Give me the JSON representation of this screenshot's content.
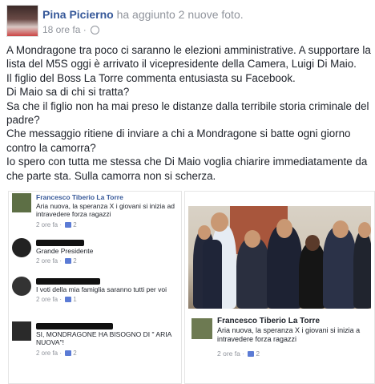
{
  "post": {
    "author": "Pina Picierno",
    "action": "ha aggiunto 2 nuove foto.",
    "time": "18 ore fa",
    "lines": [
      "A Mondragone tra poco ci saranno le elezioni amministrative. A supportare la lista del M5S oggi è arrivato il vicepresidente della Camera, Luigi Di Maio.",
      "Il figlio del Boss La Torre commenta entusiasta su Facebook.",
      "Di Maio sa di chi si tratta?",
      "Sa che il figlio non ha mai preso le distanze dalla terribile storia criminale del padre?",
      "Che messaggio ritiene di inviare a chi a Mondragone si batte ogni giorno contro la camorra?",
      "Io spero con tutta me stessa che Di Maio voglia chiarire immediatamente da che parte sta. Sulla camorra non si scherza."
    ]
  },
  "left_screenshot": {
    "comments": [
      {
        "name": "Francesco Tiberio La Torre",
        "text": "Aria nuova, la speranza X i giovani si inizia ad intravedere forza ragazzi",
        "meta": "2 ore fa",
        "likes": "2"
      },
      {
        "name": "",
        "text": "Grande Presidente",
        "meta": "2 ore fa",
        "likes": "2"
      },
      {
        "name": "",
        "text": "I voti della mia famiglia saranno tutti per voi",
        "meta": "2 ore fa",
        "likes": "1"
      },
      {
        "name": "",
        "text": "SI, MONDRAGONE HA BISOGNO DI \" ARIA NUOVA\"!",
        "meta": "2 ore fa",
        "likes": "2"
      }
    ]
  },
  "right_screenshot": {
    "caption_name": "Francesco Tiberio La Torre",
    "caption_text": "Aria nuova, la speranza X i giovani si inizia a intravedere forza ragazzi",
    "caption_meta": "2 ore fa",
    "caption_likes": "2"
  }
}
